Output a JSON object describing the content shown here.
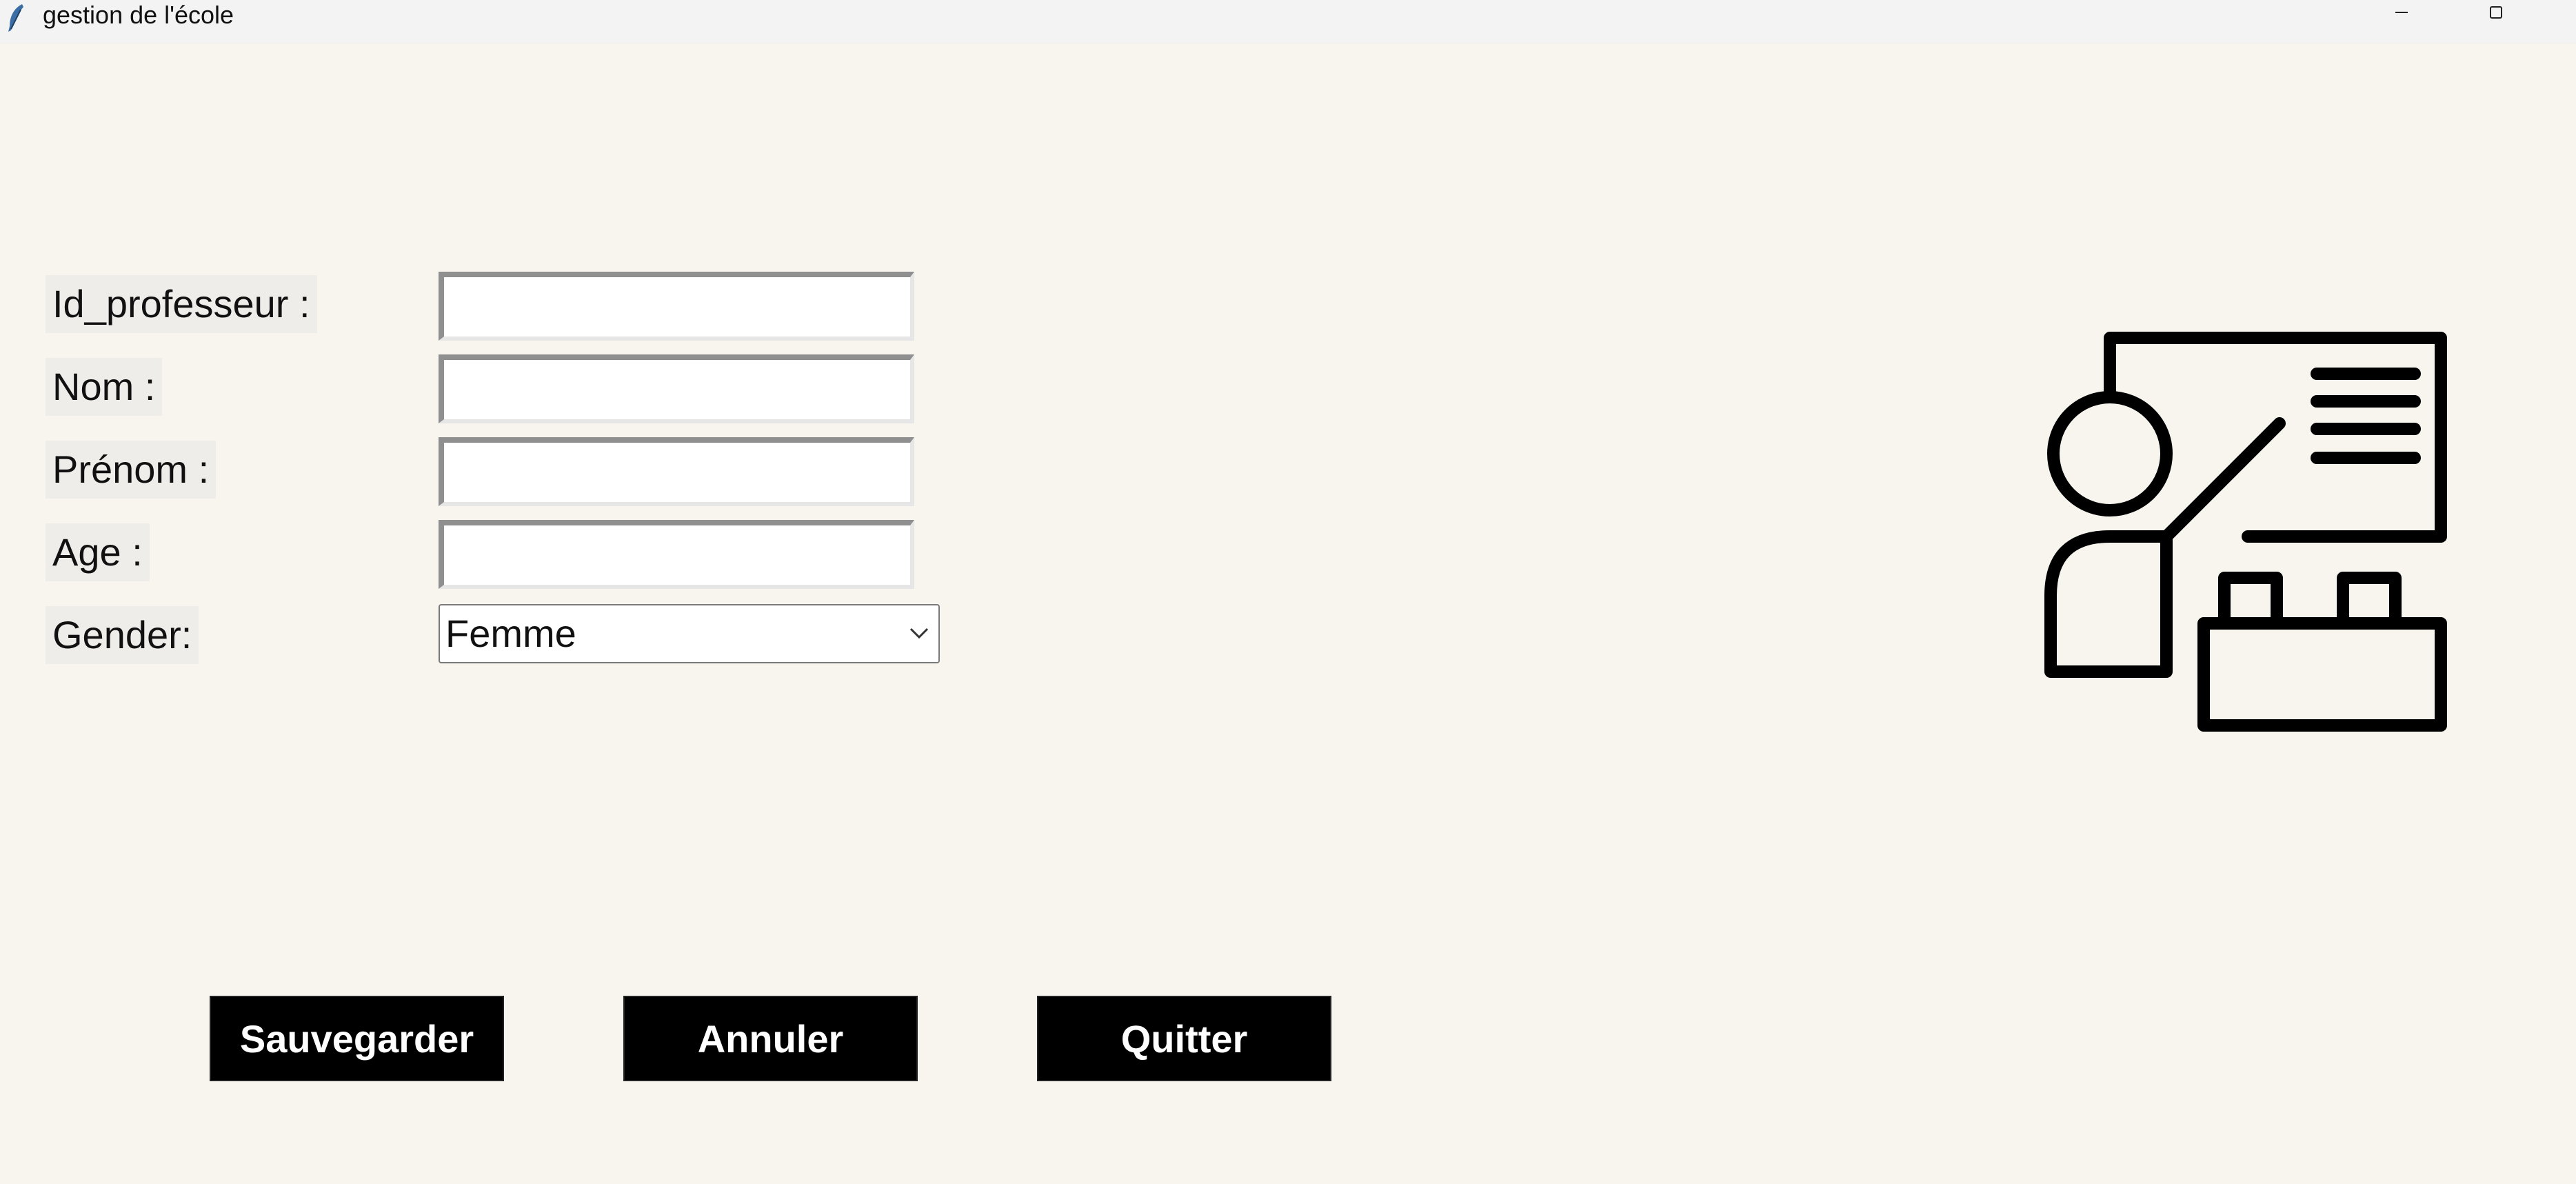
{
  "window": {
    "title": "gestion de l'école",
    "icon": "feather-icon",
    "controls": [
      "minimize-icon",
      "maximize-icon"
    ]
  },
  "form": {
    "id_label": "Id_professeur :",
    "nom_label": "Nom :",
    "prenom_label": "Prénom :",
    "age_label": "Age :",
    "gender_label": "Gender:",
    "id_value": "",
    "nom_value": "",
    "prenom_value": "",
    "age_value": "",
    "gender_value": "Femme"
  },
  "buttons": {
    "save": "Sauvegarder",
    "cancel": "Annuler",
    "quit": "Quitter"
  },
  "illustration": {
    "icon": "teacher-presentation-icon"
  },
  "colors": {
    "background": "#f8f5ee",
    "button_bg": "#000000",
    "button_text": "#ffffff"
  }
}
